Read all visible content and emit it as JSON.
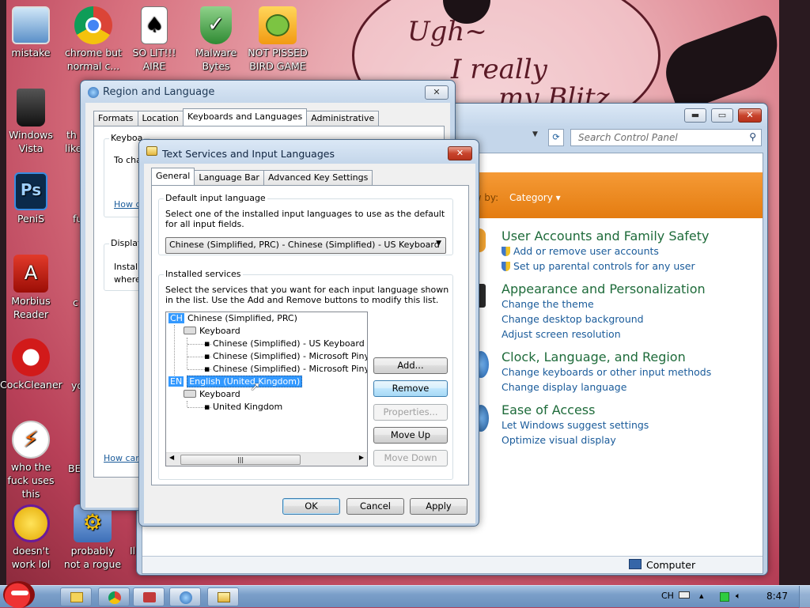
{
  "desktop": {
    "wallpaper_text": [
      "Ugh~",
      "I really",
      "my Blitz"
    ],
    "icons": [
      {
        "label": "mistake",
        "icon": "computer-icon"
      },
      {
        "label": "chrome but normal c...",
        "icon": "chrome-icon"
      },
      {
        "label": "SO LIT!!! AIRE",
        "icon": "solitaire-icon"
      },
      {
        "label": "Malware Bytes",
        "icon": "malwarebytes-icon"
      },
      {
        "label": "NOT PISSED BIRD GAME",
        "icon": "bad-piggies-icon"
      },
      {
        "label": "Windows Vista",
        "icon": "recycle-bin-icon"
      },
      {
        "label": "PeniS",
        "icon": "photoshop-icon"
      },
      {
        "label": "Morbius Reader",
        "icon": "adobe-reader-icon"
      },
      {
        "label": "CockCleaner",
        "icon": "ccleaner-icon"
      },
      {
        "label": "who the fuck uses this",
        "icon": "winamp-icon"
      },
      {
        "label": "doesn't work lol",
        "icon": "yahoo-messenger-icon"
      },
      {
        "label": "probably not a rogue",
        "icon": "rogue-gear-icon"
      }
    ],
    "partial_labels": {
      "col2_row2": "th",
      "col2_row2b": "like",
      "col2_row3": "fu",
      "col2_row4": "c",
      "col2_row5": "yo",
      "col2_row6": "BE",
      "col3_row7": "Il"
    }
  },
  "control_panel": {
    "search_placeholder": "Search Control Panel",
    "view_by_label": "View by:",
    "view_by_value": "Category",
    "categories": [
      {
        "heading": "User Accounts and Family Safety",
        "links": [
          "Add or remove user accounts",
          "Set up parental controls for any user"
        ]
      },
      {
        "heading": "Appearance and Personalization",
        "links": [
          "Change the theme",
          "Change desktop background",
          "Adjust screen resolution"
        ]
      },
      {
        "heading": "Clock, Language, and Region",
        "links": [
          "Change keyboards or other input methods",
          "Change display language"
        ]
      },
      {
        "heading": "Ease of Access",
        "links": [
          "Let Windows suggest settings",
          "Optimize visual display"
        ]
      }
    ],
    "status_computer": "Computer"
  },
  "region_language": {
    "title": "Region and Language",
    "tabs": [
      "Formats",
      "Location",
      "Keyboards and Languages",
      "Administrative"
    ],
    "active_tab": "Keyboards and Languages",
    "group1_legend": "Keyboa",
    "group1_text": "To cha",
    "group1_link": "How d",
    "group2_legend": "Display",
    "group2_text1": "Install",
    "group2_text2": "where",
    "bottom_link": "How can"
  },
  "text_services": {
    "title": "Text Services and Input Languages",
    "tabs": [
      "General",
      "Language Bar",
      "Advanced Key Settings"
    ],
    "active_tab": "General",
    "default_group": {
      "legend": "Default input language",
      "description": "Select one of the installed input languages to use as the default for all input fields.",
      "selected": "Chinese (Simplified, PRC) - Chinese (Simplified) - US Keyboard"
    },
    "installed_group": {
      "legend": "Installed services",
      "description": "Select the services that you want for each input language shown in the list. Use the Add and Remove buttons to modify this list.",
      "tree": {
        "lang1_tag": "CH",
        "lang1": "Chinese (Simplified, PRC)",
        "lang1_keyboard": "Keyboard",
        "lang1_items": [
          "Chinese (Simplified) - US Keyboard",
          "Chinese (Simplified) - Microsoft Pinyin Ne",
          "Chinese (Simplified) - Microsoft Pinyin AB"
        ],
        "lang2_tag": "EN",
        "lang2": "English (United Kingdom)",
        "lang2_keyboard": "Keyboard",
        "lang2_items": [
          "United Kingdom"
        ]
      },
      "buttons": {
        "add": "Add...",
        "remove": "Remove",
        "properties": "Properties...",
        "move_up": "Move Up",
        "move_down": "Move Down"
      }
    },
    "footer": {
      "ok": "OK",
      "cancel": "Cancel",
      "apply": "Apply"
    }
  },
  "taskbar": {
    "language": "CH",
    "clock": "8:47"
  }
}
